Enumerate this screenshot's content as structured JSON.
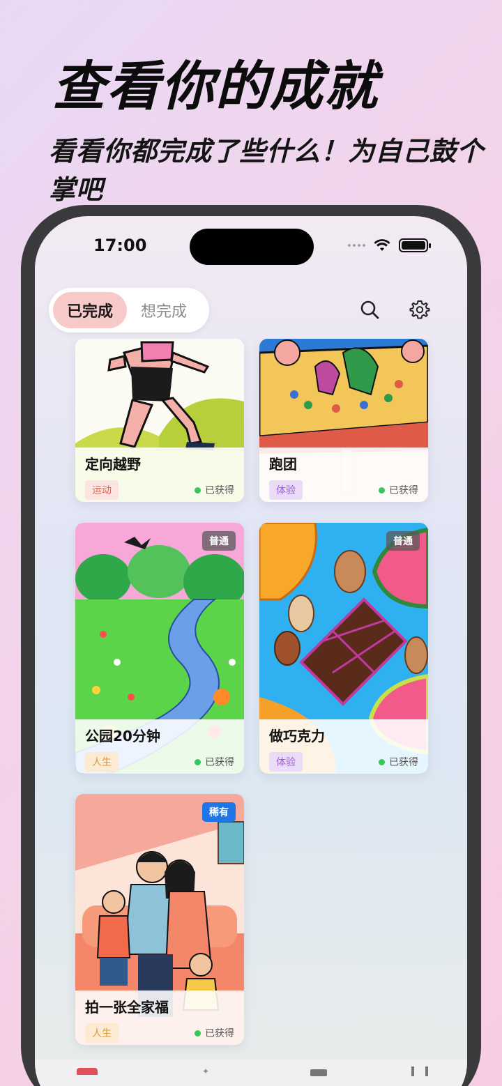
{
  "promo": {
    "title": "查看你的成就",
    "subtitle": "看看你都完成了些什么！为自己鼓个掌吧"
  },
  "status": {
    "time": "17:00"
  },
  "tabs": [
    {
      "label": "已完成",
      "active": true
    },
    {
      "label": "想完成",
      "active": false
    }
  ],
  "toolbar": {
    "search_icon": "search-icon",
    "settings_icon": "gear-icon"
  },
  "cards": [
    {
      "title": "定向越野",
      "category": "运动",
      "status": "已获得",
      "rarity": ""
    },
    {
      "title": "跑团",
      "category": "体验",
      "status": "已获得",
      "rarity": ""
    },
    {
      "title": "公园20分钟",
      "category": "人生",
      "status": "已获得",
      "rarity": "普通"
    },
    {
      "title": "做巧克力",
      "category": "体验",
      "status": "已获得",
      "rarity": "普通"
    },
    {
      "title": "拍一张全家福",
      "category": "人生",
      "status": "已获得",
      "rarity": "稀有"
    }
  ],
  "colors": {
    "active_tab": "#f7c9c9",
    "obtained_dot": "#34c759",
    "rare_badge": "#1f76e8"
  }
}
